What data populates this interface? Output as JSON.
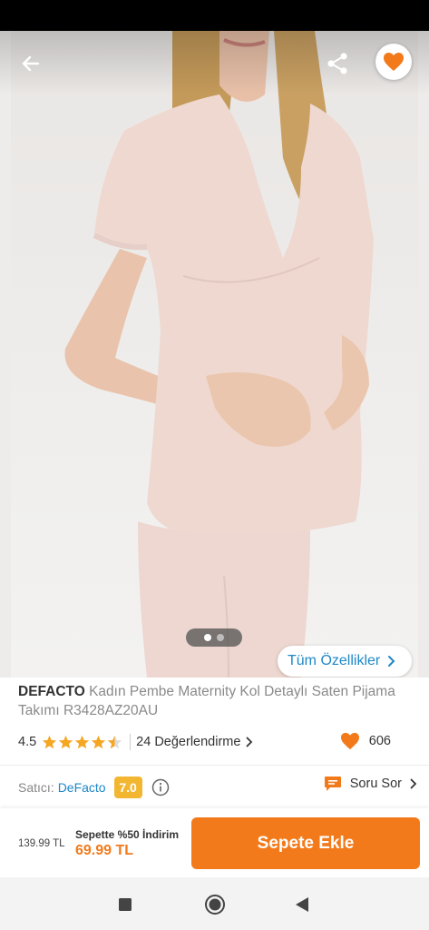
{
  "hero": {
    "image_alt": "Maternity pajama top worn by model",
    "carousel_total": 2,
    "carousel_active": 1,
    "features_label": "Tüm Özellikler"
  },
  "product": {
    "brand": "DEFACTO",
    "name": "Kadın Pembe Maternity Kol Detaylı Saten Pijama Takımı R3428AZ20AU",
    "rating": "4.5",
    "rating_value": 4.5,
    "reviews_label": "24 Değerlendirme",
    "favorites_count": "606"
  },
  "seller": {
    "label": "Satıcı:",
    "name": "DeFacto",
    "score": "7.0",
    "ask_label": "Soru Sor"
  },
  "purchase": {
    "old_price": "139.99 TL",
    "promo_label": "Sepette %50 İndirim",
    "new_price": "69.99 TL",
    "add_to_cart_label": "Sepete Ekle"
  },
  "colors": {
    "accent": "#f27a1a",
    "link": "#1e88c7",
    "star": "#f5a623",
    "score_badge": "#f2b631"
  },
  "icons": {
    "back": "arrow-left-icon",
    "share": "share-icon",
    "favorite": "heart-icon",
    "info": "info-icon",
    "question": "chat-bubble-icon"
  }
}
